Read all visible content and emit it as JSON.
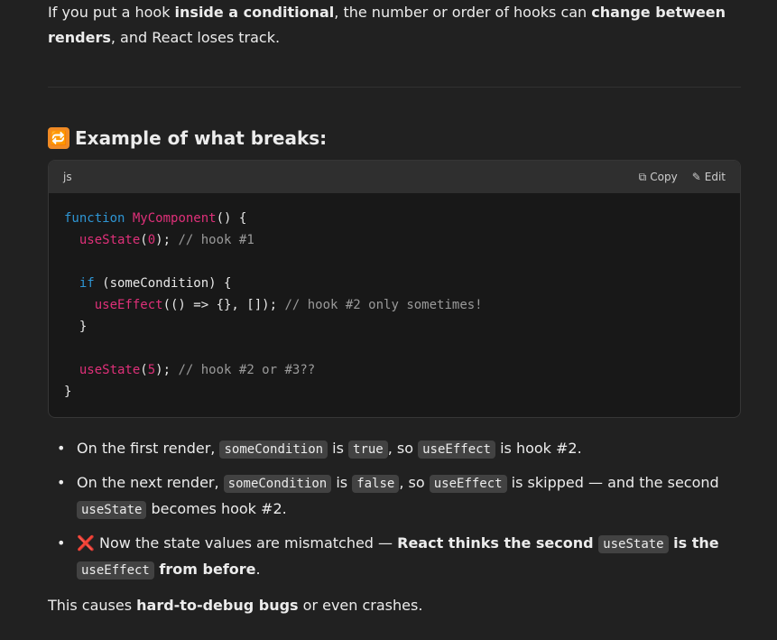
{
  "intro": {
    "t1": "If you put a hook ",
    "b1": "inside a conditional",
    "t2": ", the number or order of hooks can ",
    "b2": "change between renders",
    "t3": ", and React loses track."
  },
  "heading": {
    "emoji": "🔁",
    "text": "Example of what breaks:"
  },
  "code": {
    "language": "js",
    "copy_label": "Copy",
    "edit_label": "Edit",
    "lines": [
      "function MyComponent() {",
      "  useState(0); // hook #1",
      "",
      "  if (someCondition) {",
      "    useEffect(() => {}, []); // hook #2 only sometimes!",
      "  }",
      "",
      "  useState(5); // hook #2 or #3??",
      "}"
    ],
    "tokens": {
      "l1_kw": "function",
      "l1_fn": "MyComponent",
      "l1_rest": "() {",
      "l2_fn": "useState",
      "l2_num": "0",
      "l2_rest": ");",
      "l2_cm": "// hook #1",
      "l4_kw": "if",
      "l4_rest": " (someCondition) {",
      "l5_fn": "useEffect",
      "l5_rest": "(() => {}, []);",
      "l5_cm": "// hook #2 only sometimes!",
      "l6": "}",
      "l8_fn": "useState",
      "l8_num": "5",
      "l8_rest": ");",
      "l8_cm": "// hook #2 or #3??",
      "l9": "}"
    }
  },
  "bullets": {
    "b1": {
      "t1": "On the first render, ",
      "c1": "someCondition",
      "t2": " is ",
      "c2": "true",
      "t3": ", so ",
      "c3": "useEffect",
      "t4": " is hook #2."
    },
    "b2": {
      "t1": "On the next render, ",
      "c1": "someCondition",
      "t2": " is ",
      "c2": "false",
      "t3": ", so ",
      "c3": "useEffect",
      "t4": " is skipped — and the second ",
      "c4": "useState",
      "t5": " becomes hook #2."
    },
    "b3": {
      "icon": "❌",
      "t1": " Now the state values are mismatched — ",
      "b1": "React thinks the second ",
      "c1": "useState",
      "b2": " is the ",
      "c2": "useEffect",
      "b3": " from before",
      "t2": "."
    }
  },
  "final": {
    "t1": "This causes ",
    "b1": "hard-to-debug bugs",
    "t2": " or even crashes."
  },
  "colors": {
    "background": "#212121",
    "code_bg": "#181818",
    "keyword": "#2e95d3",
    "function": "#df3079",
    "comment": "#9a9a9a"
  }
}
